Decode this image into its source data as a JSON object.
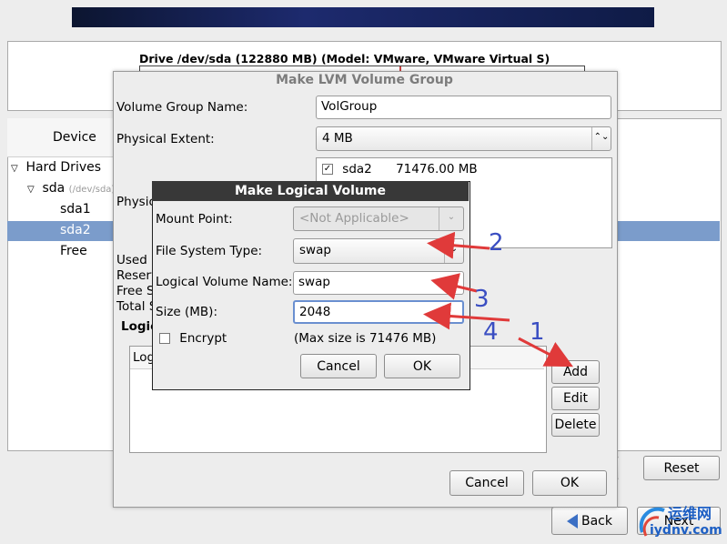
{
  "drive": {
    "title": "Drive /dev/sda (122880 MB) (Model: VMware, VMware Virtual S)"
  },
  "device_tree": {
    "header": "Device",
    "hard_drives": "Hard Drives",
    "sda": "sda",
    "sda_path": "(/dev/sda)",
    "sda1": "sda1",
    "sda2": "sda2",
    "free": "Free"
  },
  "background_labels": {
    "used": "Used S",
    "reserved": "Reserv",
    "free": "Free S",
    "total": "Total S",
    "logical": "Logic",
    "physical": "Physic",
    "lv_col": "Log"
  },
  "main_buttons": {
    "reset": "Reset",
    "back": "Back",
    "next": "Next"
  },
  "lvm_dialog": {
    "title": "Make LVM Volume Group",
    "vg_name_label": "Volume Group Name:",
    "vg_name_value": "VolGroup",
    "pe_label": "Physical Extent:",
    "pe_value": "4 MB",
    "pv_name": "sda2",
    "pv_size": "71476.00 MB",
    "add_label": "Add",
    "edit_label": "Edit",
    "delete_label": "Delete",
    "cancel_label": "Cancel",
    "ok_label": "OK"
  },
  "lv_dialog": {
    "title": "Make Logical Volume",
    "mount_label": "Mount Point:",
    "mount_placeholder": "<Not Applicable>",
    "fs_label": "File System Type:",
    "fs_value": "swap",
    "lvname_label": "Logical Volume Name:",
    "lvname_value": "swap",
    "size_label": "Size (MB):",
    "size_value": "2048",
    "encrypt_label": "Encrypt",
    "max_size": "(Max size is 71476 MB)",
    "cancel_label": "Cancel",
    "ok_label": "OK"
  },
  "annotations": {
    "n1": "1",
    "n2": "2",
    "n3": "3",
    "n4": "4"
  },
  "watermark": {
    "cn": "运维网",
    "url": "iydnv.com"
  },
  "colors": {
    "selection": "#7b9ccb",
    "arrow": "#e03a3a",
    "annotation": "#3a4ec2",
    "title_bar": "#383838"
  }
}
